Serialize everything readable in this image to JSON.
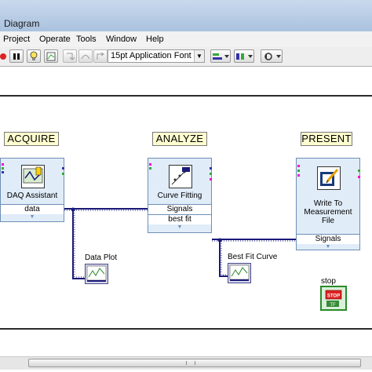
{
  "window": {
    "title": "Diagram"
  },
  "menu": [
    "Project",
    "Operate",
    "Tools",
    "Window",
    "Help"
  ],
  "toolbar": {
    "font": "15pt Application Font"
  },
  "diagram": {
    "sections": [
      "ACQUIRE",
      "ANALYZE",
      "PRESENT"
    ],
    "daq": {
      "name": "DAQ Assistant",
      "port": "data"
    },
    "curve": {
      "name": "Curve Fitting",
      "port1": "Signals",
      "port2": "best fit"
    },
    "write": {
      "name_line1": "Write To",
      "name_line2": "Measurement",
      "name_line3": "File",
      "port": "Signals"
    },
    "data_plot": "Data Plot",
    "best_fit_curve": "Best Fit Curve",
    "stop_label": "stop",
    "stop_icon_text": "STOP",
    "stop_tf": "TF"
  },
  "colors": {
    "wire": "#1a1a7a",
    "accent_yellow": "#fffed0",
    "vi_bg": "#e0ecf8"
  }
}
